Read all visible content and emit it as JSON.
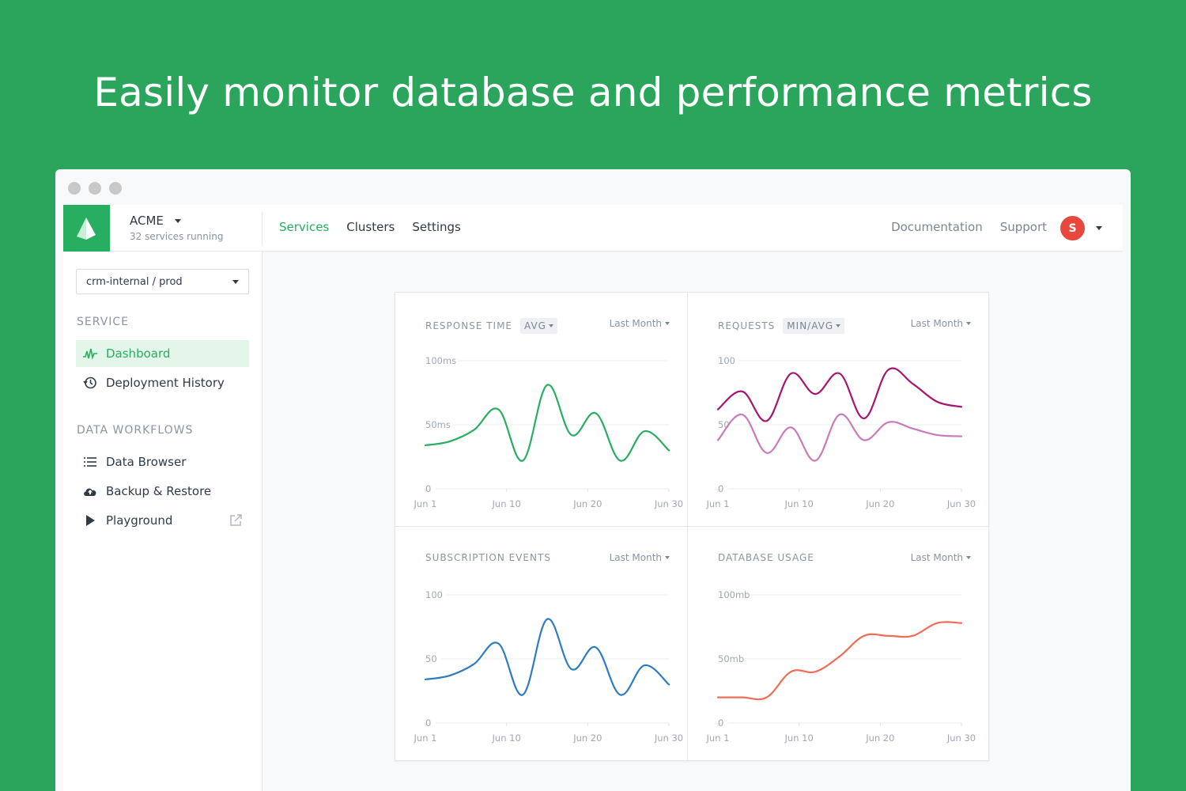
{
  "hero": {
    "title": "Easily monitor database and performance metrics"
  },
  "topbar": {
    "brand": "ACME",
    "brand_sub": "32 services running",
    "nav": [
      "Services",
      "Clusters",
      "Settings"
    ],
    "right_nav": [
      "Documentation",
      "Support"
    ],
    "avatar": "S"
  },
  "sidebar": {
    "project": "crm-internal / prod",
    "service_title": "SERVICE",
    "service_items": [
      "Dashboard",
      "Deployment History"
    ],
    "workflows_title": "DATA WORKFLOWS",
    "workflow_items": [
      "Data Browser",
      "Backup & Restore",
      "Playground"
    ]
  },
  "colors": {
    "brand": "#27ae60",
    "response": "#27ae60",
    "requests_max": "#a4166f",
    "requests_min": "#c97ab9",
    "subscriptions": "#2e7bbf",
    "database": "#ef6d56"
  },
  "chart_data": [
    {
      "type": "line",
      "title": "RESPONSE TIME",
      "filter": "AVG",
      "period": "Last Month",
      "x": [
        1,
        4,
        7,
        10,
        13,
        16,
        19,
        22,
        25,
        28,
        31
      ],
      "xticks": [
        "Jun 1",
        "Jun 10",
        "Jun 20",
        "Jun 30"
      ],
      "yticks": [
        "0",
        "50ms",
        "100ms"
      ],
      "ylim": [
        0,
        100
      ],
      "series": [
        {
          "values": [
            34,
            37,
            46,
            62,
            22,
            81,
            42,
            59,
            22,
            45,
            30
          ]
        }
      ]
    },
    {
      "type": "line",
      "title": "REQUESTS",
      "filter": "MIN/AVG",
      "period": "Last Month",
      "x": [
        1,
        4,
        7,
        10,
        13,
        16,
        19,
        22,
        25,
        28,
        31
      ],
      "xticks": [
        "Jun 1",
        "Jun 10",
        "Jun 20",
        "Jun 30"
      ],
      "yticks": [
        "0",
        "50",
        "100"
      ],
      "ylim": [
        0,
        100
      ],
      "series": [
        {
          "values": [
            62,
            76,
            53,
            90,
            74,
            90,
            55,
            93,
            82,
            68,
            64
          ]
        },
        {
          "values": [
            38,
            58,
            28,
            48,
            22,
            58,
            38,
            52,
            47,
            42,
            41
          ]
        }
      ]
    },
    {
      "type": "line",
      "title": "SUBSCRIPTION EVENTS",
      "period": "Last Month",
      "x": [
        1,
        4,
        7,
        10,
        13,
        16,
        19,
        22,
        25,
        28,
        31
      ],
      "xticks": [
        "Jun 1",
        "Jun 10",
        "Jun 20",
        "Jun 30"
      ],
      "yticks": [
        "0",
        "50",
        "100"
      ],
      "ylim": [
        0,
        100
      ],
      "series": [
        {
          "values": [
            34,
            37,
            46,
            62,
            22,
            81,
            42,
            59,
            22,
            45,
            30
          ]
        }
      ]
    },
    {
      "type": "line",
      "title": "DATABASE USAGE",
      "period": "Last Month",
      "x": [
        1,
        4,
        7,
        10,
        13,
        16,
        19,
        22,
        25,
        28,
        31
      ],
      "xticks": [
        "Jun 1",
        "Jun 10",
        "Jun 20",
        "Jun 30"
      ],
      "yticks": [
        "0",
        "50mb",
        "100mb"
      ],
      "ylim": [
        0,
        100
      ],
      "series": [
        {
          "values": [
            20,
            20,
            20,
            40,
            40,
            52,
            68,
            68,
            68,
            78,
            78
          ]
        }
      ]
    }
  ]
}
